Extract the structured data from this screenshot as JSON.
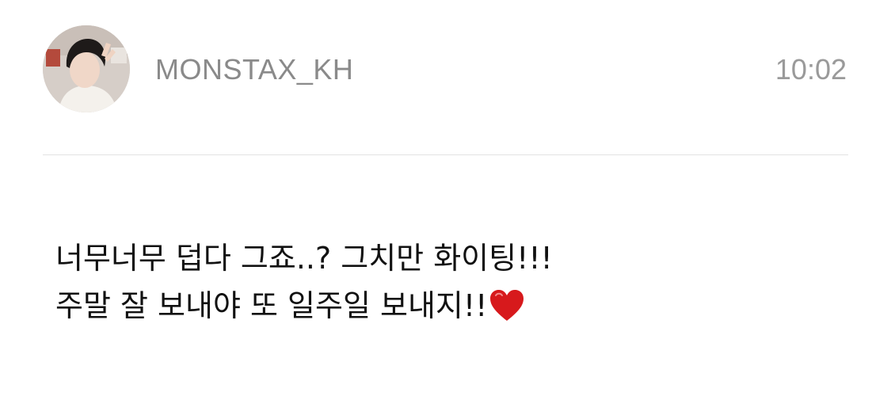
{
  "message_header": {
    "avatar_icon": "profile-photo",
    "sender": "MONSTAX_KH",
    "time": "10:02"
  },
  "message": {
    "lines": [
      "너무너무 덥다 그죠..? 그치만 화이팅!!!",
      "주말 잘 보내야 또 일주일 보내지!!"
    ],
    "end_emoji": "heart-icon",
    "end_emoji_color": "#d7191c"
  }
}
